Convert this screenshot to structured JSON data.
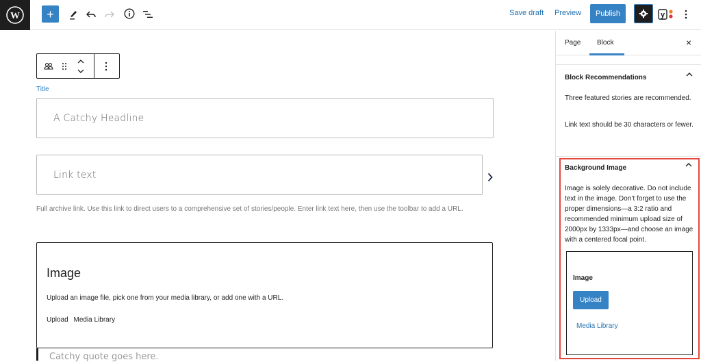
{
  "header": {
    "inserter_label": "+",
    "save_draft": "Save draft",
    "preview": "Preview",
    "publish": "Publish"
  },
  "icons": {
    "logo": "wordpress-logo",
    "tools": "pencil-icon",
    "undo": "undo-icon",
    "redo": "redo-icon",
    "details": "info-icon",
    "outline": "list-view-icon",
    "settings": "gear-icon",
    "yoast": "yoast-icon",
    "more": "more-vertical-icon"
  },
  "editor": {
    "title_label": "Title",
    "headline_placeholder": "A Catchy Headline",
    "link_placeholder": "Link text",
    "link_help": "Full archive link. Use this link to direct users to a comprehensive set of stories/people. Enter link text here, then use the toolbar to add a URL.",
    "image_block": {
      "heading": "Image",
      "instructions": "Upload an image file, pick one from your media library, or add one with a URL.",
      "upload": "Upload",
      "media_library": "Media Library"
    },
    "quote_placeholder": "Catchy quote goes here."
  },
  "sidebar": {
    "tabs": [
      {
        "label": "Page",
        "active": false
      },
      {
        "label": "Block",
        "active": true
      }
    ],
    "close_label": "×",
    "panels": {
      "recommendations": {
        "title": "Block Recommendations",
        "text1": "Three featured stories are recommended.",
        "text2": "Link text should be 30 characters or fewer."
      },
      "background": {
        "title": "Background Image",
        "text": "Image is solely decorative. Do not include text in the image. Don’t forget to use the proper dimensions—a 3:2 ratio and recommended minimum upload size of 2000px by 1333px—and choose an image with a centered focal point.",
        "image_label": "Image",
        "upload": "Upload",
        "media_library": "Media Library"
      }
    }
  },
  "colors": {
    "accent": "#3582c4",
    "highlight": "#e3463a",
    "dark": "#1e1e1e"
  }
}
